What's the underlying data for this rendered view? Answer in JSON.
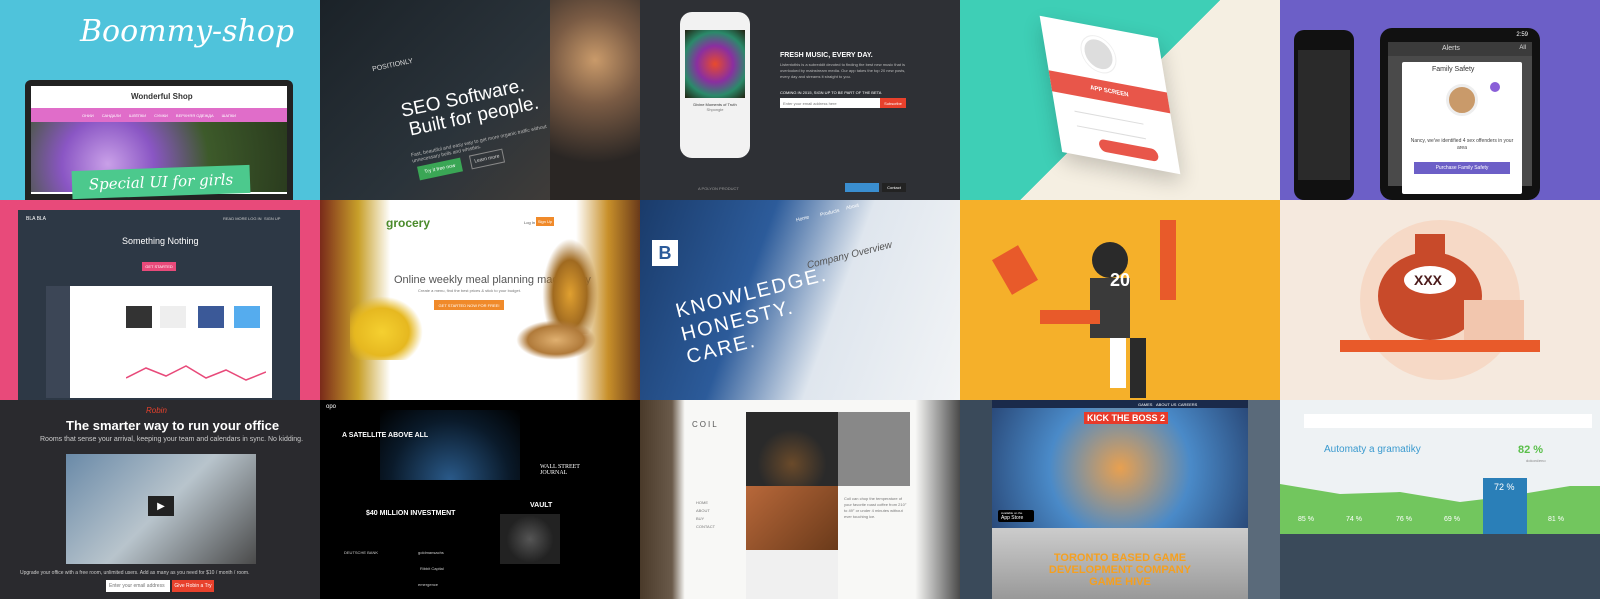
{
  "tiles": {
    "boommy": {
      "title": "Boommy-shop",
      "shop_title": "Wonderful Shop",
      "nav": [
        "ОНИИ",
        "САНДАЛИ",
        "ШЛЁПКИ",
        "СУМКИ",
        "ВЕРХНЯЯ ОДЕЖДА",
        "ШАПКИ"
      ],
      "banner": "Special UI for girls"
    },
    "positionly": {
      "logo": "POSITIONLY",
      "headline_1": "SEO Software.",
      "headline_2": "Built for people.",
      "sub": "Fast, beautiful and easy way to get more organic traffic without unnecessary bells and whistles.",
      "cta": "Try it free now",
      "cta2": "Learn more"
    },
    "music": {
      "heading": "FRESH MUSIC, EVERY DAY.",
      "body": "Listentothis is a subreddit devoted to finding the best new music that is overlooked by mainstream media. Our app takes the top 20 new posts, every day and streams it straight to you.",
      "coming": "COMING IN 2015, SIGN UP TO BE PART OF THE BETA",
      "email_placeholder": "Enter your email address here",
      "subscribe": "Subscribe",
      "song": "Divine Moments of Truth",
      "artist": "Shpongle",
      "footer": "A POLYON PRODUCT",
      "footer_btn1": "",
      "footer_btn2": "Contact"
    },
    "appscreen": {
      "label": "APP SCREEN"
    },
    "alerts": {
      "time": "2:59",
      "title": "Alerts",
      "filter": "All",
      "card_title": "Family Safety",
      "message": "Nancy, we've identified 4 sex offenders in your area",
      "button": "Purchase Family Safety"
    },
    "blabla": {
      "logo": "BLA BLA",
      "nav": [
        "READ MORE",
        "LOG IN",
        "SIGN UP"
      ],
      "title": "Something Nothing",
      "button": "GET STARTED"
    },
    "grocery": {
      "logo": "grocery",
      "headline": "Online weekly meal planning made easy",
      "sub": "Create a menu, find the best prices & stick to your budget.",
      "cta": "GET STARTED NOW FOR FREE!",
      "nav1": "Log In",
      "nav2": "Sign Up"
    },
    "knowledge": {
      "lines": [
        "KNOWLEDGE.",
        "HONESTY.",
        "CARE."
      ],
      "overview": "Company Overview",
      "nav": [
        "Home",
        "Products",
        "About"
      ]
    },
    "football": {
      "number": "20"
    },
    "xxx": {
      "label": "XXX"
    },
    "robin": {
      "logo": "Robin",
      "headline": "The smarter way to run your office",
      "sub": "Rooms that sense your arrival, keeping your team and calendars in sync. No kidding.",
      "offer": "Upgrade your office with a free room, unlimited users. Add as many as you need for $10 / month / room.",
      "placeholder": "Enter your email address",
      "button": "Give Robin a Try"
    },
    "opo": {
      "logo": "opo",
      "satellite": "A SATELLITE ABOVE ALL",
      "investment": "$40 MILLION INVESTMENT",
      "vault": "VAULT",
      "wsj": "WALL STREET JOURNAL",
      "logos": [
        "DEUTSCHE BANK",
        "goldmansachs",
        "Ribbit Capital",
        "emergence"
      ]
    },
    "coil": {
      "logo": "COIL",
      "nav": [
        "HOME",
        "ABOUT",
        "BUY",
        "CONTACT"
      ],
      "text": "Coil can chop the temperature of your favorite roast coffee from 210° to 49° or under 4 minutes without ever touching ice."
    },
    "kickboss": {
      "logo": "KICK THE BOSS 2",
      "nav": [
        "GAMES",
        "ABOUT US",
        "CAREERS"
      ],
      "store": "App Store",
      "store_small": "Available on the",
      "headline_1": "TORONTO BASED GAME",
      "headline_2": "DEVELOPMENT COMPANY",
      "headline_3": "GAME HIVE"
    },
    "automaty": {
      "title": "Automaty a gramatiky",
      "percent": "82 %",
      "percent_sub": "dokončeno",
      "bars": [
        "85 %",
        "74 %",
        "76 %",
        "69 %",
        "72 %",
        "81 %"
      ],
      "highlight": "72 %"
    }
  },
  "colors": {
    "boommy_bg": "#4FC3DB",
    "pink_nav": "#E06DC9",
    "green_banner": "#4CC98D",
    "music_red": "#E8412C",
    "teal": "#3ECFB6",
    "purple": "#6C5FC7",
    "blabla_pink": "#E84A7A",
    "football_yellow": "#F5B02A",
    "blue_highlight": "#2A7FB8",
    "green_chart": "#72C65E"
  }
}
